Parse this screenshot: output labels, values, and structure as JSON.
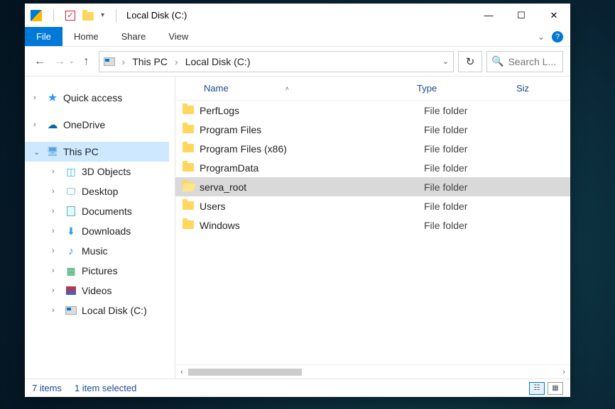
{
  "window": {
    "title": "Local Disk (C:)"
  },
  "tabs": {
    "file": "File",
    "home": "Home",
    "share": "Share",
    "view": "View"
  },
  "breadcrumb": {
    "root": "This PC",
    "current": "Local Disk (C:)"
  },
  "search": {
    "placeholder": "Search L..."
  },
  "columns": {
    "name": "Name",
    "type": "Type",
    "size": "Siz"
  },
  "navpane": {
    "quick_access": "Quick access",
    "onedrive": "OneDrive",
    "this_pc": "This PC",
    "objects3d": "3D Objects",
    "desktop": "Desktop",
    "documents": "Documents",
    "downloads": "Downloads",
    "music": "Music",
    "pictures": "Pictures",
    "videos": "Videos",
    "local_disk": "Local Disk (C:)"
  },
  "files": [
    {
      "name": "PerfLogs",
      "type": "File folder",
      "selected": false
    },
    {
      "name": "Program Files",
      "type": "File folder",
      "selected": false
    },
    {
      "name": "Program Files (x86)",
      "type": "File folder",
      "selected": false
    },
    {
      "name": "ProgramData",
      "type": "File folder",
      "selected": false
    },
    {
      "name": "serva_root",
      "type": "File folder",
      "selected": true
    },
    {
      "name": "Users",
      "type": "File folder",
      "selected": false
    },
    {
      "name": "Windows",
      "type": "File folder",
      "selected": false
    }
  ],
  "status": {
    "count": "7 items",
    "selection": "1 item selected"
  }
}
